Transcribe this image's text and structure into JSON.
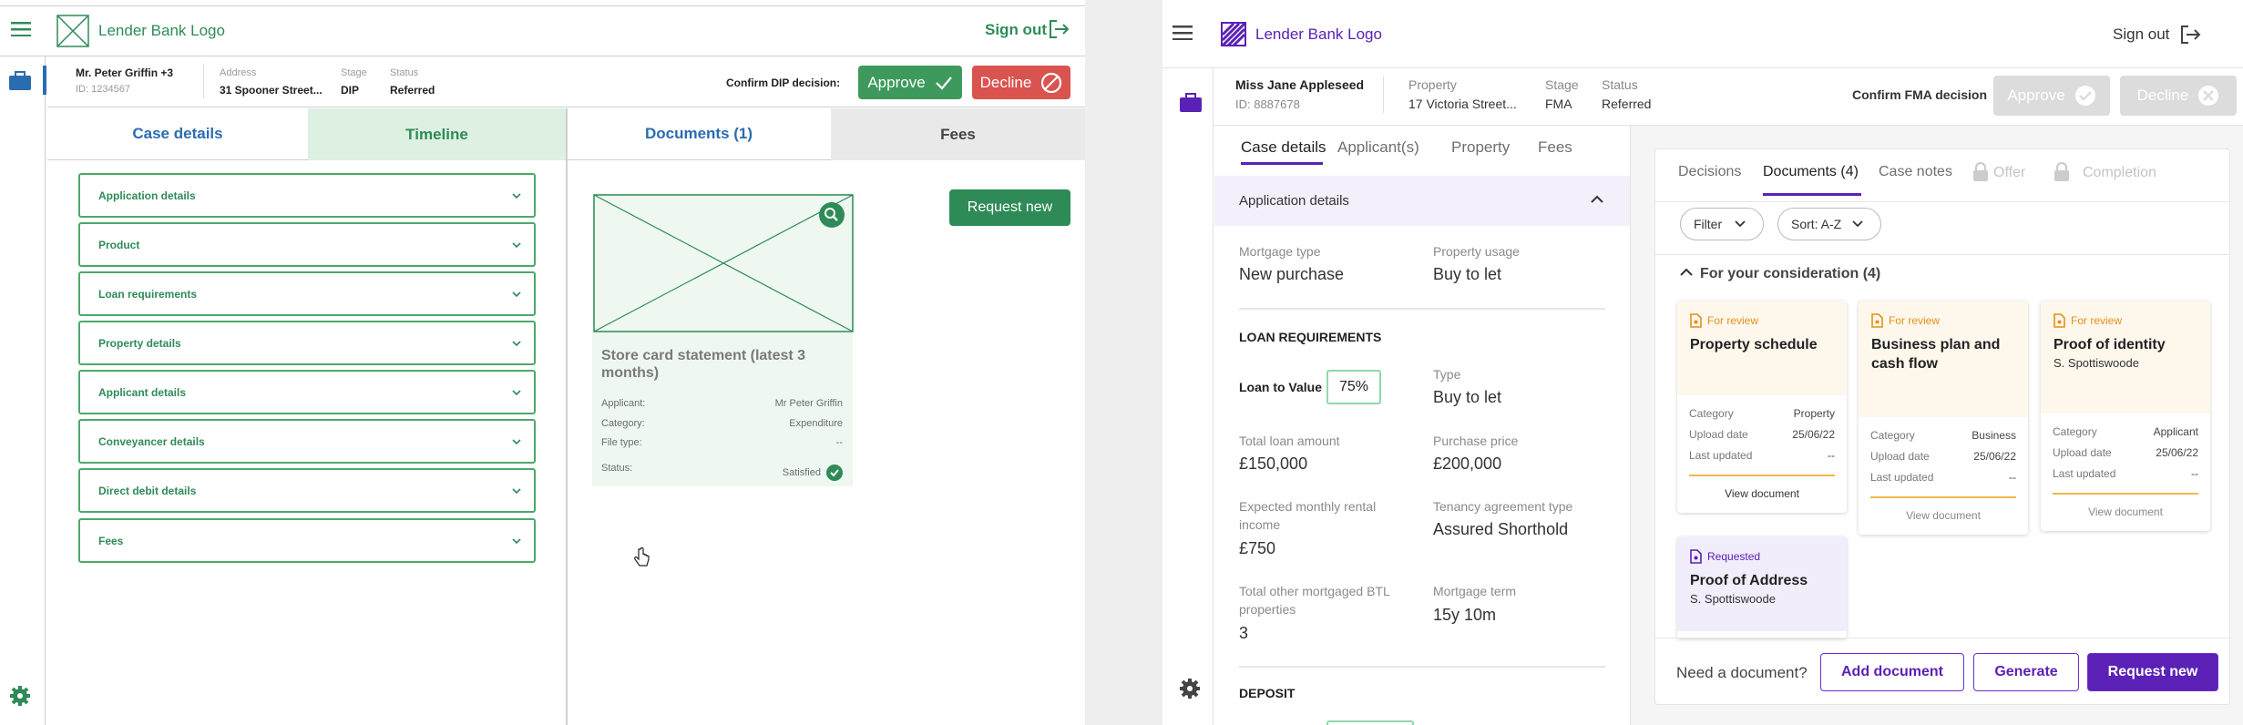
{
  "left": {
    "logo_text": "Lender Bank Logo",
    "sign_out": "Sign out",
    "case": {
      "applicant_name": "Mr. Peter Griffin +3",
      "applicant_id": "ID: 1234567",
      "address_label": "Address",
      "address_value": "31 Spooner Street...",
      "stage_label": "Stage",
      "stage_value": "DIP",
      "status_label": "Status",
      "status_value": "Referred",
      "confirm_label": "Confirm DIP decision:",
      "approve": "Approve",
      "decline": "Decline"
    },
    "tabs": [
      "Case details",
      "Timeline",
      "Documents (1)",
      "Fees"
    ],
    "accordion": [
      "Application details",
      "Product",
      "Loan requirements",
      "Property details",
      "Applicant details",
      "Conveyancer details",
      "Direct debit details",
      "Fees"
    ],
    "request_new": "Request new",
    "document": {
      "title": "Store card statement (latest 3 months)",
      "rows": [
        {
          "label": "Applicant:",
          "value": "Mr Peter Griffin"
        },
        {
          "label": "Category:",
          "value": "Expenditure"
        },
        {
          "label": "File type:",
          "value": "--"
        },
        {
          "label": "Status:",
          "value": "Satisfied"
        }
      ]
    },
    "colors": {
      "green": "#2e8b57",
      "approve": "#3d9a5c",
      "decline": "#d9534f",
      "tab_active_bg": "#ddf0e2"
    }
  },
  "right": {
    "logo_text": "Lender Bank Logo",
    "sign_out": "Sign out",
    "case": {
      "applicant_name": "Miss Jane Appleseed",
      "applicant_id": "ID: 8887678",
      "property_label": "Property",
      "property_value": "17 Victoria Street...",
      "stage_label": "Stage",
      "stage_value": "FMA",
      "status_label": "Status",
      "status_value": "Referred",
      "confirm_label": "Confirm FMA decision",
      "approve": "Approve",
      "decline": "Decline"
    },
    "main_tabs": [
      "Case details",
      "Applicant(s)",
      "Property",
      "Fees"
    ],
    "section_title": "Application details",
    "fields": {
      "mortgage_type_label": "Mortgage type",
      "mortgage_type_value": "New purchase",
      "property_usage_label": "Property usage",
      "property_usage_value": "Buy to let",
      "loan_requirements_heading": "LOAN REQUIREMENTS",
      "ltv_label": "Loan to Value",
      "ltv_value": "75%",
      "type_label": "Type",
      "type_value": "Buy to let",
      "total_loan_label": "Total loan amount",
      "total_loan_value": "£150,000",
      "purchase_price_label": "Purchase price",
      "purchase_price_value": "£200,000",
      "rental_label": "Expected monthly rental income",
      "rental_value": "£750",
      "tenancy_label": "Tenancy agreement type",
      "tenancy_value": "Assured Shorthold",
      "other_btl_label": "Total other mortgaged BTL properties",
      "other_btl_value": "3",
      "term_label": "Mortgage term",
      "term_value": "15y 10m",
      "deposit_heading": "DEPOSIT"
    },
    "side_tabs": [
      "Decisions",
      "Documents (4)",
      "Case notes",
      "Offer",
      "Completion"
    ],
    "filter": "Filter",
    "sort": "Sort: A-Z",
    "group_title": "For your consideration (4)",
    "cards": [
      {
        "status": "For review",
        "title": "Property schedule",
        "subtitle": "",
        "category": "Property",
        "upload": "25/06/22",
        "updated": "--"
      },
      {
        "status": "For review",
        "title": "Business plan and cash flow",
        "subtitle": "",
        "category": "Business",
        "upload": "25/06/22",
        "updated": "--"
      },
      {
        "status": "For review",
        "title": "Proof of identity",
        "subtitle": "S. Spottiswoode",
        "category": "Applicant",
        "upload": "25/06/22",
        "updated": "--"
      },
      {
        "status": "Requested",
        "title": "Proof of Address",
        "subtitle": "S. Spottiswoode"
      }
    ],
    "card_labels": {
      "category": "Category",
      "upload": "Upload date",
      "updated": "Last updated",
      "view": "View document"
    },
    "need_doc": "Need a document?",
    "add_document": "Add document",
    "generate": "Generate",
    "request_new": "Request new",
    "colors": {
      "purple": "#5b21b6",
      "amber": "#f0a22e"
    }
  }
}
